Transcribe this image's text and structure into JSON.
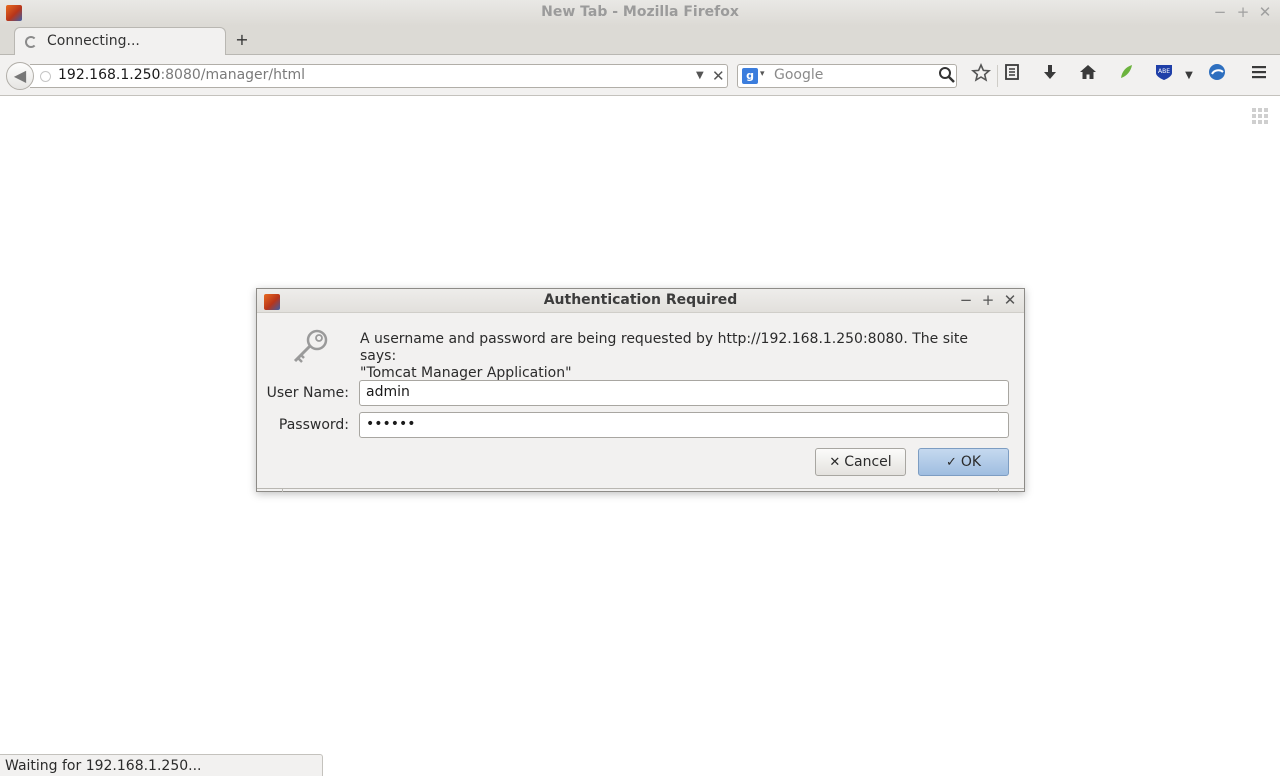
{
  "window": {
    "title": "New Tab - Mozilla Firefox",
    "controls": {
      "minimize": "−",
      "maximize": "+",
      "close": "✕"
    }
  },
  "tabs": [
    {
      "label": "Connecting...",
      "loading": true
    }
  ],
  "tabstrip": {
    "new_tab": "+"
  },
  "navbar": {
    "url_host": "192.168.1.250",
    "url_rest": ":8080/manager/html",
    "url_dropdown": "▼",
    "url_stop": "✕",
    "search": {
      "engine": "g",
      "engine_dropdown": "▾",
      "placeholder": "Google"
    },
    "toolbar_icons": [
      "bookmark-star-icon",
      "reading-list-icon",
      "downloads-icon",
      "home-icon",
      "leaf-addon-icon",
      "adblock-abe-icon",
      "persona-icon",
      "menu-icon"
    ]
  },
  "dialog": {
    "title": "Authentication Required",
    "controls": {
      "minimize": "−",
      "maximize": "+",
      "close": "✕"
    },
    "message_line1": "A username and password are being requested by http://192.168.1.250:8080. The site says:",
    "message_line2": "\"Tomcat Manager Application\"",
    "username_label": "User Name:",
    "username_value": "admin",
    "password_label": "Password:",
    "password_value": "••••••",
    "cancel_label": "Cancel",
    "ok_label": "OK"
  },
  "statusbar": {
    "text": "Waiting for 192.168.1.250..."
  },
  "colors": {
    "ok_button": "#9fbde0",
    "chrome_bg": "#f2f1f0",
    "title_text": "#9b9b9b"
  }
}
